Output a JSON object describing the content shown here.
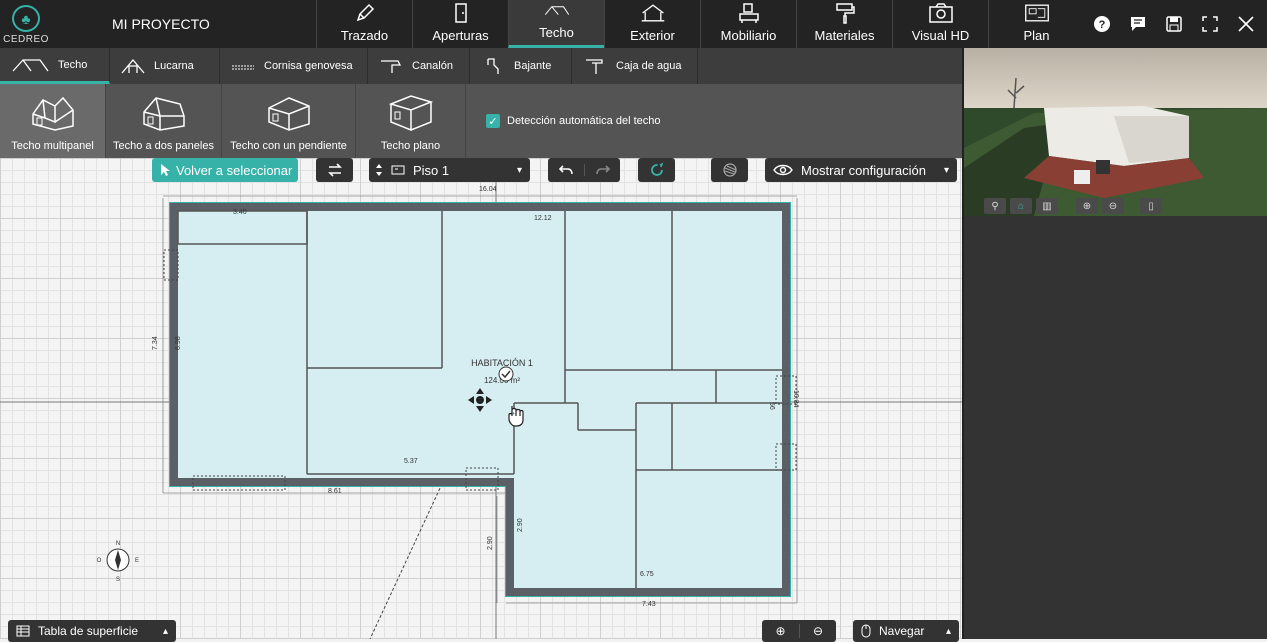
{
  "app": {
    "logo_text": "CEDREO",
    "project_name": "MI PROYECTO"
  },
  "main_tabs": [
    {
      "label": "Trazado",
      "icon": "pencil-icon"
    },
    {
      "label": "Aperturas",
      "icon": "door-icon"
    },
    {
      "label": "Techo",
      "icon": "roof-icon",
      "active": true
    },
    {
      "label": "Exterior",
      "icon": "house-exterior-icon"
    },
    {
      "label": "Mobiliario",
      "icon": "furniture-icon"
    },
    {
      "label": "Materiales",
      "icon": "paint-roller-icon"
    },
    {
      "label": "Visual HD",
      "icon": "camera-icon"
    },
    {
      "label": "Plan",
      "icon": "plan-icon"
    }
  ],
  "sub_tabs": [
    {
      "label": "Techo",
      "active": true
    },
    {
      "label": "Lucarna"
    },
    {
      "label": "Cornisa genovesa"
    },
    {
      "label": "Canalón"
    },
    {
      "label": "Bajante"
    },
    {
      "label": "Caja de agua"
    }
  ],
  "roof_types": [
    {
      "label": "Techo multipanel",
      "active": true
    },
    {
      "label": "Techo a dos paneles"
    },
    {
      "label": "Techo con un pendiente"
    },
    {
      "label": "Techo plano"
    }
  ],
  "auto_detect": {
    "label": "Detección automática del techo",
    "checked": true
  },
  "toolbar": {
    "reselect": "Volver a seleccionar",
    "floor": "Piso 1",
    "show_config": "Mostrar configuración"
  },
  "plan": {
    "room_name": "HABITACIÓN 1",
    "room_area": "124.00 m²",
    "dims": {
      "top_total": "16.04",
      "top_left": "3.40",
      "top_right": "12.12",
      "left_outer": "7.34",
      "left_inner": "6.98",
      "mid_bottom": "5.37",
      "bottom_left": "8.61",
      "right_side": "56",
      "right_side2": "10.34",
      "stair_v1": "2.90",
      "stair_v2": "2.90",
      "bottom_inner": "6.75",
      "bottom_right": "7.43"
    }
  },
  "compass": {
    "n": "N",
    "s": "S",
    "e": "E",
    "o": "O"
  },
  "bottom": {
    "surface_table": "Tabla de superficie",
    "navigate": "Navegar"
  },
  "colors": {
    "accent": "#37b2a9",
    "wall": "#5a6066",
    "room_fill": "#d6edf1"
  }
}
